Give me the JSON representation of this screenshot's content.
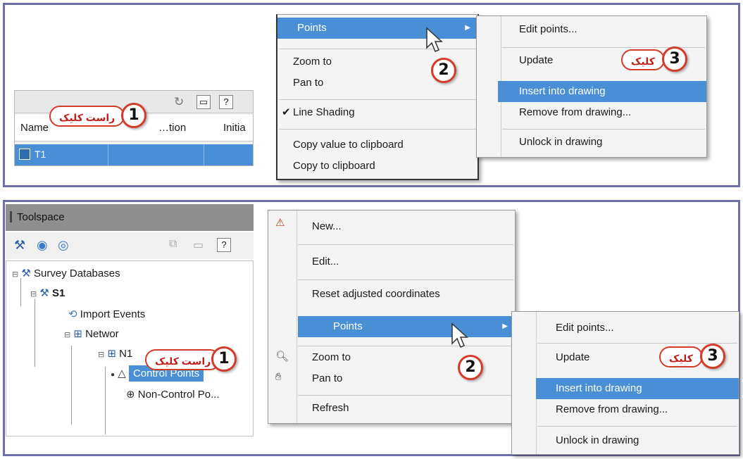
{
  "top": {
    "grid": {
      "columns": [
        "Name",
        "…tion",
        "Initia"
      ],
      "row_label": "T1",
      "help_icon": "?"
    },
    "context_menu": {
      "items": [
        "Points",
        "Zoom to",
        "Pan to",
        "Line Shading",
        "Copy value to clipboard",
        "Copy to clipboard"
      ],
      "checked": "Line Shading"
    },
    "submenu": {
      "items": [
        "Edit points...",
        "Update",
        "Insert into drawing",
        "Remove from drawing...",
        "Unlock in drawing"
      ],
      "highlighted": "Insert into drawing"
    },
    "annotations": {
      "step1_num": "1",
      "step1_text": "راست کلیک",
      "step2_num": "2",
      "step3_num": "3",
      "step3_text": "کلیک"
    }
  },
  "bottom": {
    "toolspace": {
      "title": "Toolspace",
      "help_icon": "?",
      "tree": {
        "survey_databases": "Survey Databases",
        "s1": "S1",
        "import_events": "Import Events",
        "networks": "Networ",
        "n1": "N1",
        "control_points": "Control Points",
        "non_control_points": "Non-Control Po..."
      }
    },
    "context_menu": {
      "items": [
        "New...",
        "Edit...",
        "Reset adjusted coordinates",
        "Points",
        "Zoom to",
        "Pan to",
        "Refresh"
      ]
    },
    "submenu": {
      "items": [
        "Edit points...",
        "Update",
        "Insert into drawing",
        "Remove from drawing...",
        "Unlock in drawing"
      ],
      "highlighted": "Insert into drawing"
    },
    "annotations": {
      "step1_num": "1",
      "step1_text": "راست کلیک",
      "step2_num": "2",
      "step3_num": "3",
      "step3_text": "کلیک"
    }
  },
  "colors": {
    "highlight": "#4a8fd6",
    "frame": "#6f6fa8",
    "callout_border": "#d43c2a"
  }
}
